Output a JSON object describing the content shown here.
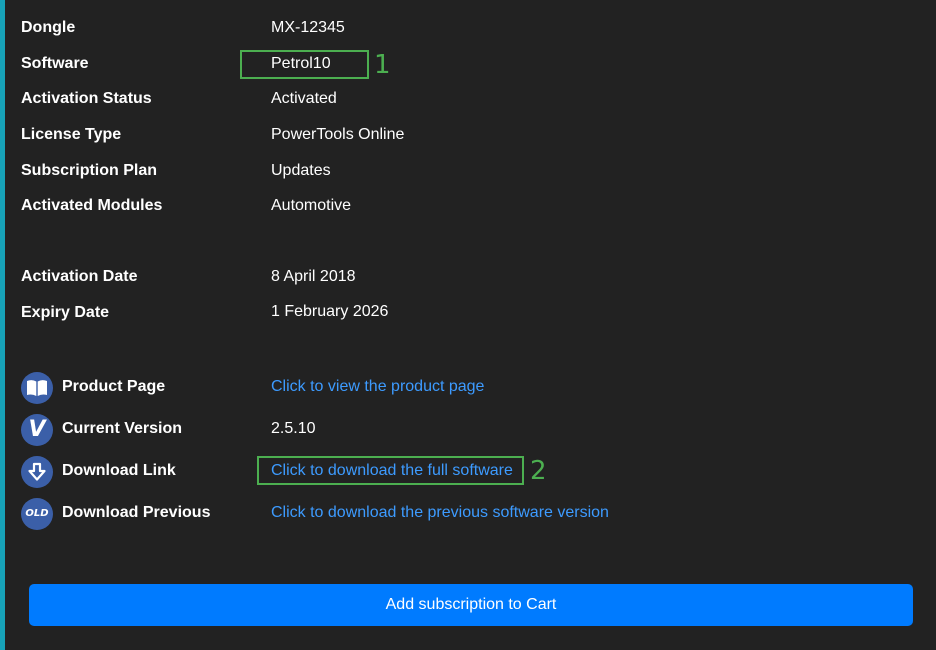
{
  "info": {
    "dongle_label": "Dongle",
    "dongle_value": "MX-12345",
    "software_label": "Software",
    "software_value": "Petrol10",
    "activation_status_label": "Activation Status",
    "activation_status_value": "Activated",
    "license_type_label": "License Type",
    "license_type_value": "PowerTools Online",
    "subscription_plan_label": "Subscription Plan",
    "subscription_plan_value": "Updates",
    "activated_modules_label": "Activated Modules",
    "activated_modules_value": "Automotive"
  },
  "dates": {
    "activation_date_label": "Activation Date",
    "activation_date_value": "8 April 2018",
    "expiry_date_label": "Expiry Date",
    "expiry_date_value": "1 February 2026"
  },
  "resources": {
    "product_page_label": "Product Page",
    "product_page_link": "Click to view the product page",
    "product_page_icon": "book-icon",
    "current_version_label": "Current Version",
    "current_version_value": "2.5.10",
    "current_version_icon": "version-v-icon",
    "version_icon_letter": "V",
    "download_link_label": "Download Link",
    "download_link_text": "Click to download the full software",
    "download_link_icon": "download-arrow-icon",
    "download_previous_label": "Download Previous",
    "download_previous_text": "Click to download the previous software version",
    "download_previous_icon": "old-badge-icon",
    "old_icon_text": "OLD"
  },
  "annotations": {
    "marker_1": "1",
    "marker_2": "2",
    "color": "#4caf50"
  },
  "cart": {
    "button_label": "Add subscription to Cart"
  },
  "colors": {
    "background": "#222222",
    "accent_bar": "#17a2b8",
    "link": "#3d9bff",
    "button": "#007bff",
    "icon_circle": "#3b5fa8"
  }
}
